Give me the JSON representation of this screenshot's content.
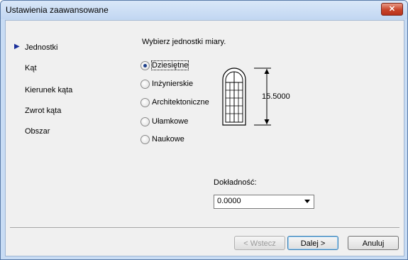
{
  "window": {
    "title": "Ustawienia zaawansowane",
    "close_glyph": "✕"
  },
  "nav": {
    "items": [
      {
        "label": "Jednostki",
        "active": true
      },
      {
        "label": "Kąt"
      },
      {
        "label": "Kierunek kąta"
      },
      {
        "label": "Zwrot kąta"
      },
      {
        "label": "Obszar"
      }
    ]
  },
  "main": {
    "prompt": "Wybierz jednostki miary.",
    "options": [
      {
        "label": "Dziesiętne",
        "selected": true
      },
      {
        "label": "Inżynierskie"
      },
      {
        "label": "Architektoniczne"
      },
      {
        "label": "Ułamkowe"
      },
      {
        "label": "Naukowe"
      }
    ],
    "preview_value": "15.5000",
    "precision_label": "Dokładność:",
    "precision_value": "0.0000"
  },
  "buttons": {
    "back": "< Wstecz",
    "next": "Dalej >",
    "cancel": "Anuluj"
  }
}
